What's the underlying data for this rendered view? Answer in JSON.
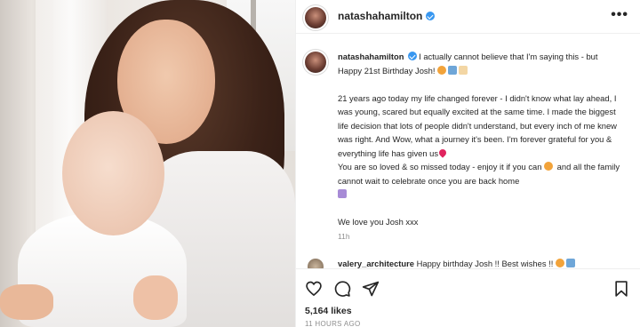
{
  "header": {
    "username": "natashahamilton",
    "more_label": "•••"
  },
  "caption": {
    "username": "natashahamilton",
    "line1": " I actually cannot believe that I'm saying this - but Happy 21st Birthday Josh! ",
    "para2": "21 years ago today my life changed forever - I didn't know what lay ahead, I was young, scared but equally excited at the same time. I made the biggest life decision that lots of people didn't understand, but every inch of me knew was right. And Wow, what a journey it's been. I'm forever grateful for you & everything life has given us",
    "para3a": "You are so loved & so missed today - enjoy it if you can ",
    "para3b": " and all the family cannot wait to celebrate once you are back home",
    "para4": "We love you Josh xxx",
    "timestamp": "11h"
  },
  "comment": {
    "username": "valery_architecture",
    "text": " Happy birthday Josh !! Best wishes !! "
  },
  "footer": {
    "likes": "5,164 likes",
    "time_ago": "11 HOURS AGO"
  },
  "icons": {
    "like": "heart-icon",
    "comment": "comment-icon",
    "share": "share-icon",
    "save": "bookmark-icon",
    "verified": "verified-badge-icon",
    "more": "more-options-icon"
  },
  "colors": {
    "verified": "#3897f0",
    "secondary_text": "#8e8e8e",
    "primary_text": "#262626"
  }
}
